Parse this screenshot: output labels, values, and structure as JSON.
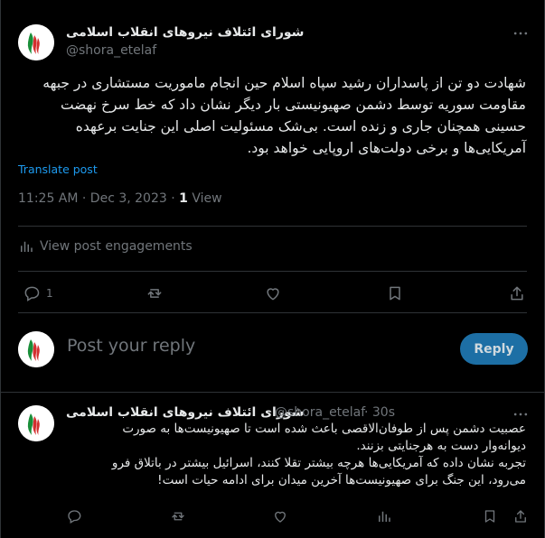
{
  "post": {
    "author_name": "شورای ائتلاف نیروهای انقلاب اسلامی",
    "author_handle": "@shora_etelaf",
    "text": "شهادت دو تن از پاسداران رشید سپاه اسلام حین انجام ماموریت مستشاری در جبهه\nمقاومت سوریه  توسط دشمن صهیونیستی بار دیگر نشان داد  که خط سرخ نهضت\nحسینی همچنان جاری و زنده است. بی‌شک مسئولیت اصلی این جنایت برعهده\nآمریکایی‌ها و برخی دولت‌های اروپایی خواهد بود.",
    "translate_label": "Translate post",
    "timestamp": "11:25 AM · Dec 3, 2023 · ",
    "view_count": "1",
    "view_label": " View",
    "engagements_label": "View post engagements",
    "reply_count": "1"
  },
  "compose": {
    "placeholder": "Post your reply",
    "button_label": "Reply"
  },
  "reply": {
    "author_name": "شورای ائتلاف نیروهای انقلاب اسلامی",
    "author_handle": "@shora_etelaf",
    "time": "· 30s",
    "text": "عصبیت دشمن پس از طوفان‌الاقصی باعث شده است تا صهیونیست‌ها به صورت\nدیوانه‌وار  دست به هرجنایتی بزنند.\nتجربه نشان داده که آمریکایی‌ها هرچه بیشتر تقلا کنند، اسرائیل بیشتر در باتلاق فرو\nمی‌رود، این جنگ برای صهیونیست‌ها آخرین میدان برای ادامه حیات است!"
  },
  "icons": {
    "more": "more-horizontal-icon",
    "reply": "reply-bubble-icon",
    "repost": "repost-icon",
    "like": "heart-icon",
    "bookmark": "bookmark-icon",
    "share": "share-icon",
    "analytics": "analytics-bars-icon"
  },
  "colors": {
    "background": "#000000",
    "text": "#e7e9ea",
    "muted": "#71767b",
    "accent": "#1d9bf0",
    "reply_button": "#1d6fa5",
    "border": "#2f3336"
  }
}
